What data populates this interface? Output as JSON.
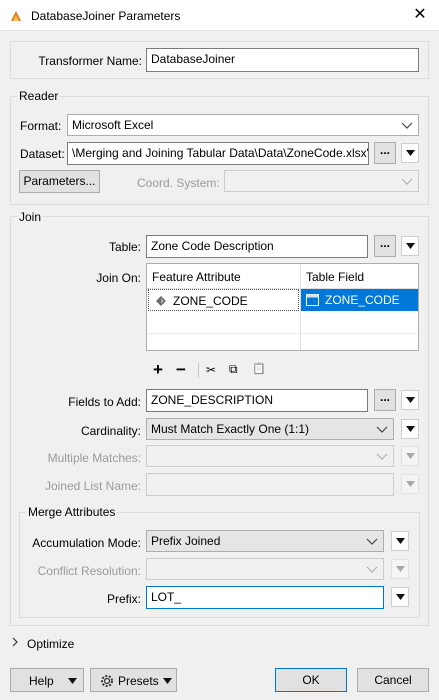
{
  "window": {
    "title": "DatabaseJoiner Parameters",
    "close_label": "✕"
  },
  "transformer": {
    "label": "Transformer Name:",
    "value": "DatabaseJoiner"
  },
  "reader": {
    "section_label": "Reader",
    "format_label": "Format:",
    "format_value": "Microsoft Excel",
    "dataset_label": "Dataset:",
    "dataset_value": "\\Merging and Joining Tabular Data\\Data\\ZoneCode.xlsx\"",
    "parameters_button": "Parameters...",
    "coord_label": "Coord. System:",
    "coord_value": ""
  },
  "join": {
    "section_label": "Join",
    "table_label": "Table:",
    "table_value": "Zone Code Description",
    "join_on_label": "Join On:",
    "columns": [
      "Feature Attribute",
      "Table Field"
    ],
    "rows": [
      {
        "feature": "ZONE_CODE",
        "field": "ZONE_CODE"
      }
    ],
    "toolbar": {
      "add": "+",
      "remove": "−",
      "cut": "✂",
      "copy": "⧉",
      "paste": "📋"
    },
    "fields_label": "Fields to Add:",
    "fields_value": "ZONE_DESCRIPTION",
    "cardinality_label": "Cardinality:",
    "cardinality_value": "Must Match Exactly One (1:1)",
    "multiple_label": "Multiple Matches:",
    "multiple_value": "",
    "joined_list_label": "Joined List Name:",
    "joined_list_value": ""
  },
  "merge": {
    "section_label": "Merge Attributes",
    "accum_label": "Accumulation Mode:",
    "accum_value": "Prefix Joined",
    "conflict_label": "Conflict Resolution:",
    "conflict_value": "",
    "prefix_label": "Prefix:",
    "prefix_value": "LOT_"
  },
  "optimize": {
    "label": "Optimize"
  },
  "footer": {
    "help": "Help",
    "presets": "Presets",
    "ok": "OK",
    "cancel": "Cancel"
  },
  "colors": {
    "accent": "#0078d7",
    "selected_row": "#0078d7"
  }
}
